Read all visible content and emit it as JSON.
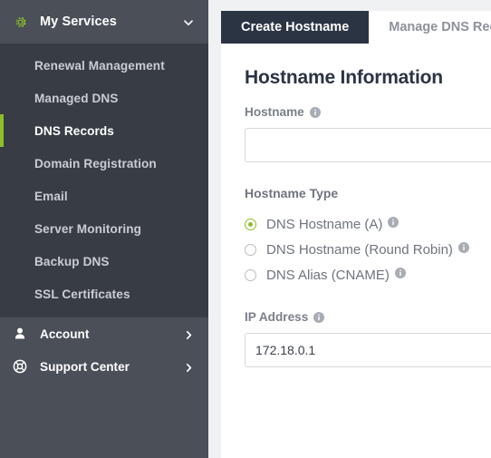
{
  "sidebar": {
    "header": {
      "label": "My Services",
      "icon": "gear-icon",
      "chevron": "chevron-down-icon"
    },
    "items": [
      {
        "label": "Renewal Management",
        "active": false
      },
      {
        "label": "Managed DNS",
        "active": false
      },
      {
        "label": "DNS Records",
        "active": true
      },
      {
        "label": "Domain Registration",
        "active": false
      },
      {
        "label": "Email",
        "active": false
      },
      {
        "label": "Server Monitoring",
        "active": false
      },
      {
        "label": "Backup DNS",
        "active": false
      },
      {
        "label": "SSL Certificates",
        "active": false
      }
    ],
    "bottom": [
      {
        "label": "Account",
        "icon": "user-icon",
        "chevron": "chevron-right-icon"
      },
      {
        "label": "Support Center",
        "icon": "lifebuoy-icon",
        "chevron": "chevron-right-icon"
      }
    ]
  },
  "main": {
    "tabs": [
      {
        "label": "Create Hostname",
        "active": true
      },
      {
        "label": "Manage DNS Records",
        "active": false
      }
    ],
    "card_title": "Hostname Information",
    "hostname": {
      "label": "Hostname",
      "info_icon": "info-icon",
      "value": "",
      "placeholder": ""
    },
    "hostname_type": {
      "title": "Hostname Type",
      "options": [
        {
          "label": "DNS Hostname (A)",
          "selected": true,
          "info_icon": "info-icon"
        },
        {
          "label": "DNS Hostname (Round Robin)",
          "selected": false,
          "info_icon": "info-icon"
        },
        {
          "label": "DNS Alias (CNAME)",
          "selected": false,
          "info_icon": "info-icon"
        }
      ]
    },
    "ip_address": {
      "label": "IP Address",
      "info_icon": "info-icon",
      "value": "172.18.0.1",
      "placeholder": ""
    }
  },
  "colors": {
    "accent_green": "#8cbf26",
    "sidebar_bg": "#4a4f58",
    "submenu_bg": "#383d45",
    "tab_active_bg": "#2b3443",
    "page_bg": "#f0f1f3"
  }
}
